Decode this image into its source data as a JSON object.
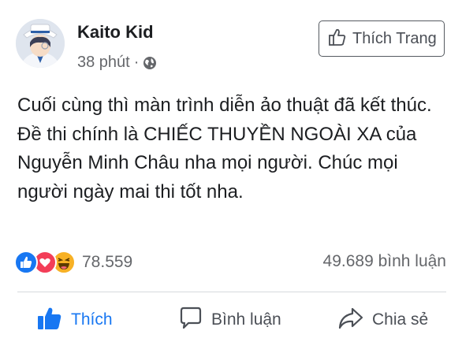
{
  "post": {
    "author": "Kaito Kid",
    "time": "38 phút",
    "separator": "·",
    "privacy_icon": "globe-icon",
    "like_page_label": "Thích Trang",
    "text": "Cuối cùng thì màn trình diễn ảo thuật đã kết thúc. Đề thi chính là CHIẾC THUYỀN NGOÀI XA của Nguyễn Minh Châu nha mọi người. Chúc mọi người ngày mai thi tốt nha.",
    "reaction_count": "78.559",
    "comment_count": "49.689 bình luận"
  },
  "actions": {
    "like": "Thích",
    "comment": "Bình luận",
    "share": "Chia sẻ"
  },
  "colors": {
    "accent": "#1877f2",
    "love": "#f33e58",
    "haha": "#f7b125",
    "muted": "#65676b"
  }
}
